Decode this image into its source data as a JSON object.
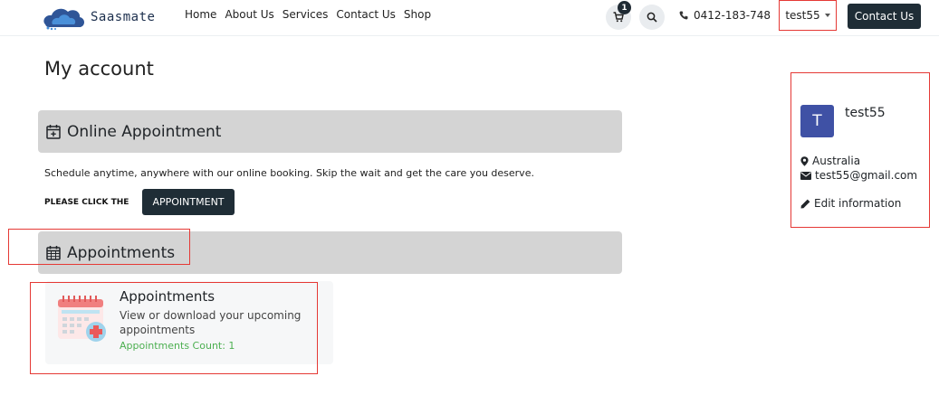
{
  "brand": {
    "name": "Saasmate"
  },
  "nav": {
    "links": [
      "Home",
      "About Us",
      "Services",
      "Contact Us",
      "Shop"
    ],
    "cart_count": "1",
    "phone": "0412-183-748",
    "user": "test55",
    "contact_button": "Contact Us"
  },
  "page": {
    "title": "My account"
  },
  "online_appointment": {
    "title": "Online Appointment",
    "description": "Schedule anytime, anywhere with our online booking. Skip the wait and get the care you deserve.",
    "click_label": "PLEASE CLICK THE",
    "button_label": "APPOINTMENT"
  },
  "appointments_section": {
    "title": "Appointments"
  },
  "appointments_card": {
    "title": "Appointments",
    "description": "View or download your upcoming appointments",
    "count_text": "Appointments Count: 1"
  },
  "profile": {
    "avatar_initial": "T",
    "name": "test55",
    "country": "Australia",
    "email": "test55@gmail.com",
    "edit_label": "Edit information"
  },
  "colors": {
    "brand_dark": "#1f2d36",
    "section_bar": "#d4d4d4",
    "avatar": "#3f51a5",
    "count_green": "#4caf50",
    "highlight_red": "#e53935"
  },
  "icons": [
    "logo-icon",
    "cart-icon",
    "search-icon",
    "phone-icon",
    "calendar-plus-icon",
    "calendar-icon",
    "appointment-calendar-icon",
    "map-marker-icon",
    "envelope-icon",
    "pencil-icon"
  ]
}
